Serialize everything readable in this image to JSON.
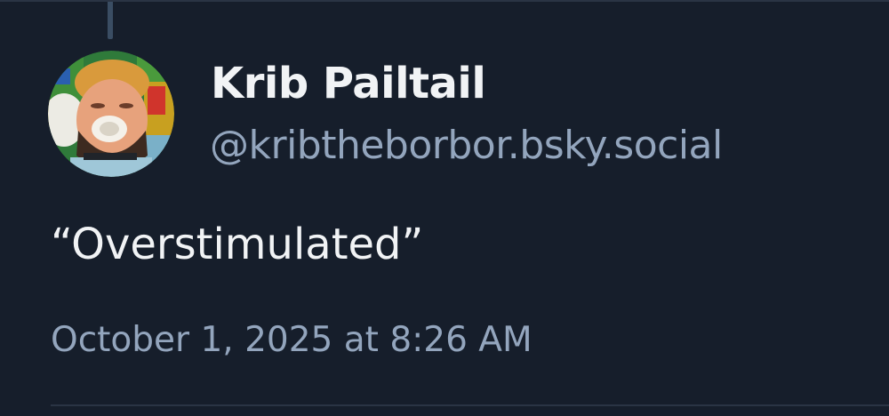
{
  "post": {
    "author": {
      "display_name": "Krib Pailtail",
      "handle": "@kribtheborbor.bsky.social"
    },
    "text": "“Overstimulated”",
    "timestamp": "October 1, 2025 at 8:26 AM"
  },
  "colors": {
    "background": "#161e2b",
    "primary_text": "#f1f3f5",
    "secondary_text": "#93a5bd",
    "thread_line": "#3a4d63",
    "divider": "#2a3444"
  }
}
